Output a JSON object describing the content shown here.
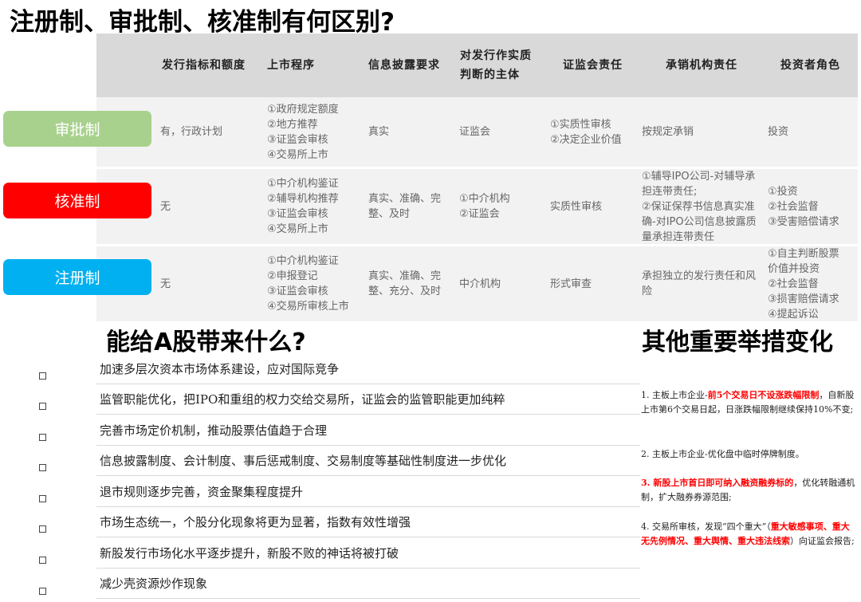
{
  "main_title": "注册制、审批制、核准制有何区别?",
  "table": {
    "headers": [
      "发行指标和额度",
      "上市程序",
      "信息披露要求",
      "对发行作实质\n判断的主体",
      "证监会责任",
      "承销机构责任",
      "投资者角色"
    ],
    "rows": [
      {
        "label": "审批制",
        "label_color": "#a9d18e",
        "cells": [
          "有，行政计划",
          "①政府规定额度\n②地方推荐\n③证监会审核\n④交易所上市",
          "真实",
          "证监会",
          "①实质性审核\n②决定企业价值",
          "按规定承销",
          "投资"
        ]
      },
      {
        "label": "核准制",
        "label_color": "#ff0000",
        "cells": [
          "无",
          "①中介机构鉴证\n②辅导机构推荐\n③证监会审核\n④交易所上市",
          "真实、准确、完\n整、及时",
          "①中介机构\n②证监会",
          "实质性审核",
          "①辅导IPO公司-对辅导承\n担连带责任;\n②保证保荐书信息真实准\n确-对IPO公司信息披露质\n量承担连带责任",
          "①投资\n②社会监督\n③受害赔偿请求"
        ]
      },
      {
        "label": "注册制",
        "label_color": "#00b0f0",
        "cells": [
          "无",
          "①中介机构鉴证\n②申报登记\n③证监会审核\n④交易所审核上市",
          "真实、准确、完\n整、充分、及时",
          "中介机构",
          "形式审查",
          "承担独立的发行责任和风\n险",
          "①自主判断股票\n价值并投资\n②社会监督\n③损害赔偿请求\n④提起诉讼"
        ]
      }
    ]
  },
  "section1": {
    "title": "能给A股带来什么?",
    "bullet_glyph": "□",
    "items": [
      "加速多层次资本市场体系建设，应对国际竞争",
      "监管职能优化，把IPO和重组的权力交给交易所，证监会的监管职能更加纯粹",
      "完善市场定价机制，推动股票估值趋于合理",
      "信息披露制度、会计制度、事后惩戒制度、交易制度等基础性制度进一步优化",
      "退市规则逐步完善，资金聚集程度提升",
      "市场生态统一，个股分化现象将更为显著，指数有效性增强",
      "新股发行市场化水平逐步提升，新股不败的神话将被打破",
      "减少壳资源炒作现象"
    ]
  },
  "section2": {
    "title": "其他重要举措变化",
    "m1": {
      "a": "1. 主板上市企业-",
      "b": "前5个交易日不设涨跌幅限制",
      "c": "，自新股上市第6个交易日起，日涨跌幅限制继续保持10%不变;"
    },
    "m2": {
      "a": "2. 主板上市企业-优化盘中临时停牌制度。"
    },
    "m3": {
      "a": "3. 新股上市首日即可纳入融资融券标的",
      "b": "，优化转融通机制，扩大融券券源范围;"
    },
    "m4": {
      "a": "4. 交易所审核，发现“四个重大”（",
      "b": "重大敏感事项、重大无先例情况、重大舆情、重大违法线索",
      "c": "）向证监会报告;"
    }
  }
}
